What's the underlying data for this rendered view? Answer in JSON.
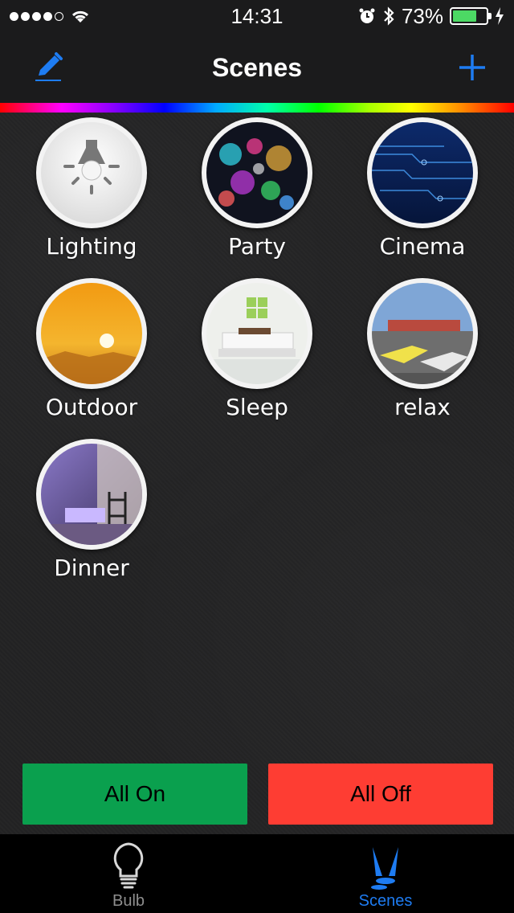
{
  "status_bar": {
    "time": "14:31",
    "battery_percent": "73%",
    "battery_level": 0.73,
    "signal_bars": 4,
    "signal_max": 5
  },
  "nav": {
    "title": "Scenes",
    "edit_icon": "pencil-icon",
    "add_icon": "plus-icon"
  },
  "scenes": [
    {
      "label": "Lighting",
      "image": "bulb-image"
    },
    {
      "label": "Party",
      "image": "bokeh-lights-image"
    },
    {
      "label": "Cinema",
      "image": "circuit-image"
    },
    {
      "label": "Outdoor",
      "image": "sunset-image"
    },
    {
      "label": "Sleep",
      "image": "bedroom-image"
    },
    {
      "label": "relax",
      "image": "racing-image"
    },
    {
      "label": "Dinner",
      "image": "room-image"
    }
  ],
  "actions": {
    "all_on": "All On",
    "all_off": "All Off"
  },
  "tab_bar": {
    "tabs": [
      {
        "label": "Bulb",
        "icon": "bulb-icon",
        "selected": false
      },
      {
        "label": "Scenes",
        "icon": "scenes-icon",
        "selected": true
      }
    ]
  },
  "colors": {
    "accent": "#1e7cf2",
    "all_on": "#0aa04e",
    "all_off": "#fe3d33"
  }
}
